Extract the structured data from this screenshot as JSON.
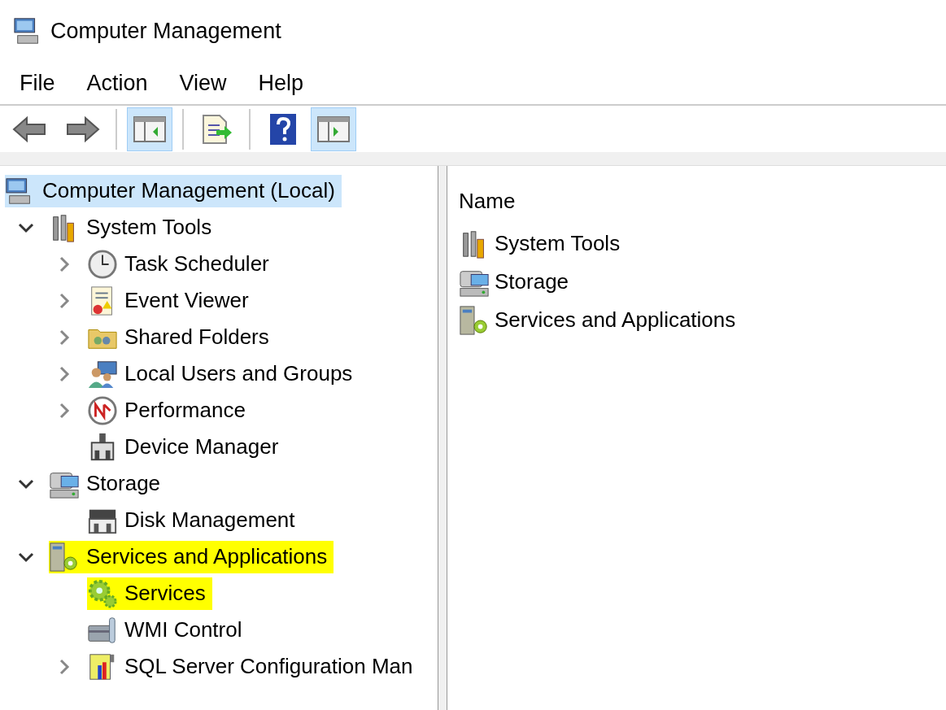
{
  "window": {
    "title": "Computer Management"
  },
  "menu": [
    "File",
    "Action",
    "View",
    "Help"
  ],
  "toolbar": [
    {
      "kind": "back",
      "pressed": false
    },
    {
      "kind": "forward",
      "pressed": false
    },
    {
      "kind": "separator"
    },
    {
      "kind": "tree-toggle",
      "pressed": true
    },
    {
      "kind": "separator"
    },
    {
      "kind": "export",
      "pressed": false
    },
    {
      "kind": "separator"
    },
    {
      "kind": "help",
      "pressed": false
    },
    {
      "kind": "action-toggle",
      "pressed": true
    }
  ],
  "tree": {
    "label": "Computer Management (Local)",
    "kind": "computer",
    "selected": true,
    "children": [
      {
        "label": "System Tools",
        "kind": "tools",
        "expandable": true,
        "expanded": true,
        "highlighted": false,
        "children": [
          {
            "label": "Task Scheduler",
            "kind": "clock",
            "expandable": true,
            "expanded": false,
            "highlighted": false
          },
          {
            "label": "Event Viewer",
            "kind": "log",
            "expandable": true,
            "expanded": false,
            "highlighted": false
          },
          {
            "label": "Shared Folders",
            "kind": "folder",
            "expandable": true,
            "expanded": false,
            "highlighted": false
          },
          {
            "label": "Local Users and Groups",
            "kind": "users",
            "expandable": true,
            "expanded": false,
            "highlighted": false
          },
          {
            "label": "Performance",
            "kind": "gauge",
            "expandable": true,
            "expanded": false,
            "highlighted": false
          },
          {
            "label": "Device Manager",
            "kind": "device",
            "expandable": false,
            "highlighted": false
          }
        ]
      },
      {
        "label": "Storage",
        "kind": "storage",
        "expandable": true,
        "expanded": true,
        "highlighted": false,
        "children": [
          {
            "label": "Disk Management",
            "kind": "disk",
            "expandable": false,
            "highlighted": false
          }
        ]
      },
      {
        "label": "Services and Applications",
        "kind": "server",
        "expandable": true,
        "expanded": true,
        "highlighted": true,
        "children": [
          {
            "label": "Services",
            "kind": "gears",
            "expandable": false,
            "highlighted": true
          },
          {
            "label": "WMI Control",
            "kind": "toolbox",
            "expandable": false,
            "highlighted": false
          },
          {
            "label": "SQL Server Configuration Man",
            "kind": "config",
            "expandable": true,
            "expanded": false,
            "highlighted": false
          }
        ]
      }
    ]
  },
  "list": {
    "column": "Name",
    "items": [
      {
        "label": "System Tools",
        "kind": "tools"
      },
      {
        "label": "Storage",
        "kind": "storage"
      },
      {
        "label": "Services and Applications",
        "kind": "server"
      }
    ]
  }
}
